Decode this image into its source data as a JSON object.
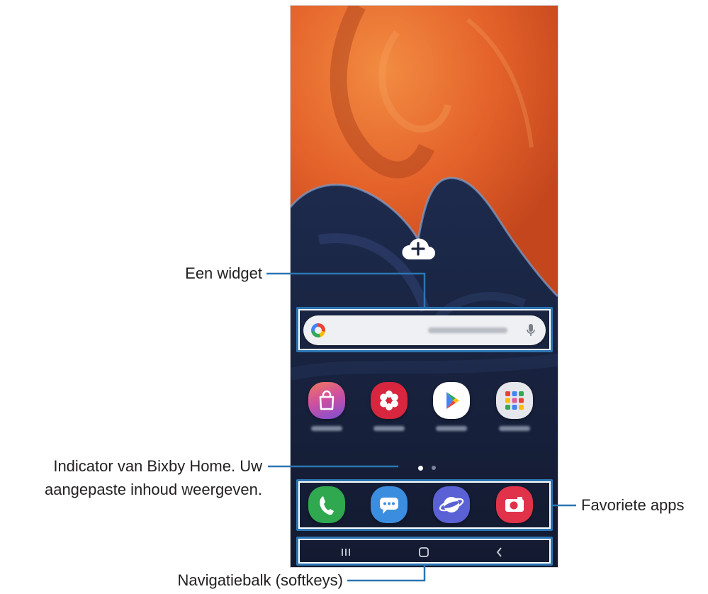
{
  "callouts": {
    "widget": "Een widget",
    "bixby_line1": "Indicator van Bixby Home. Uw",
    "bixby_line2": "aangepaste inhoud weergeven.",
    "favorites": "Favoriete apps",
    "navbar": "Navigatiebalk (softkeys)"
  },
  "colors": {
    "callout_line": "#2b76b3",
    "wallpaper_orange": "#e8672c",
    "wallpaper_navy": "#17223f"
  },
  "home_screen": {
    "widget_icon": "cloud-add-icon",
    "search_widget": {
      "left_icon": "google-g-icon",
      "right_icon": "mic-icon"
    },
    "app_grid": [
      {
        "icon": "galaxy-store-icon",
        "color": "#d0509e"
      },
      {
        "icon": "gallery-icon",
        "color": "#d7263d"
      },
      {
        "icon": "play-store-icon",
        "color": "#ffffff"
      },
      {
        "icon": "google-folder-icon",
        "color": "#e6e7ec"
      }
    ],
    "page_indicator_dots": 2,
    "dock": [
      {
        "icon": "phone-icon",
        "color": "#2fa84f"
      },
      {
        "icon": "messages-icon",
        "color": "#3b8de0"
      },
      {
        "icon": "internet-icon",
        "color": "#5a61d4"
      },
      {
        "icon": "camera-icon",
        "color": "#e0334a"
      }
    ]
  },
  "navigation_bar": {
    "icons": [
      "recent-apps-icon",
      "home-icon",
      "back-icon"
    ]
  }
}
